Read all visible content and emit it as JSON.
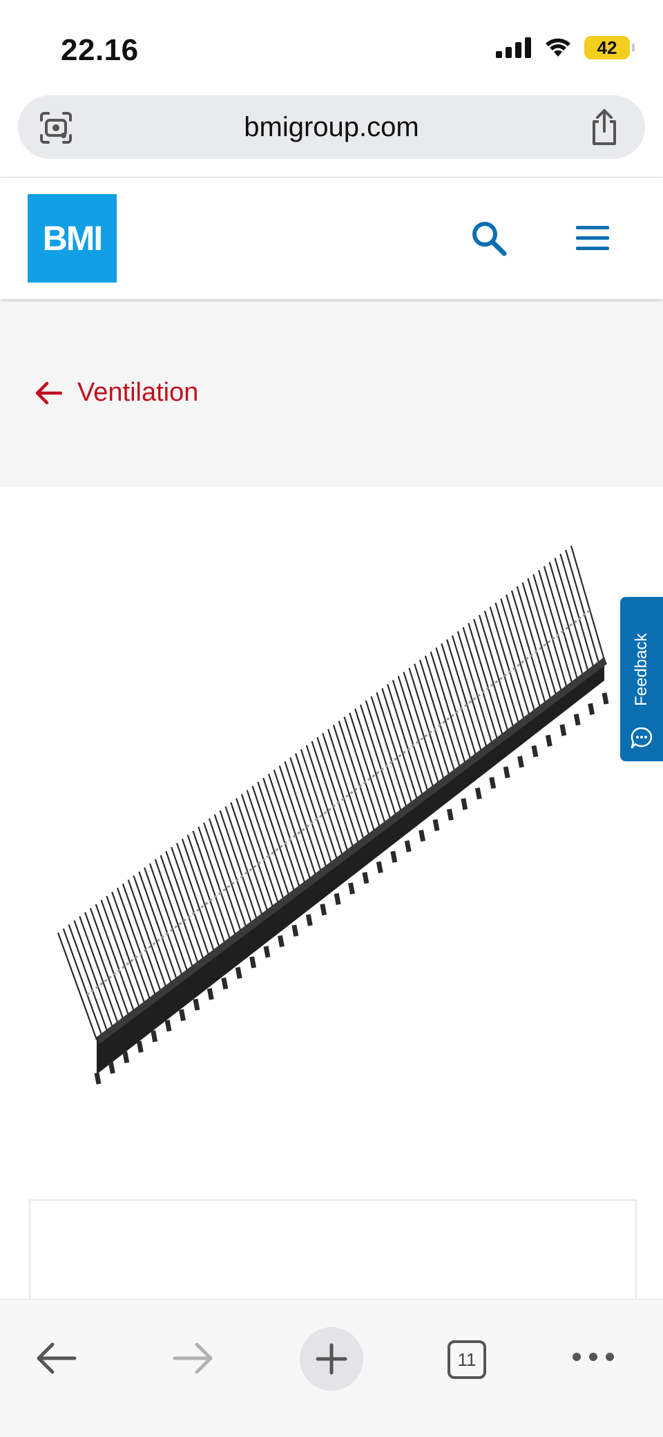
{
  "status_bar": {
    "time": "22.16",
    "battery": "42",
    "icons": [
      "signal-icon",
      "wifi-icon",
      "battery-icon"
    ]
  },
  "browser": {
    "url": "bmigroup.com",
    "left_icon": "visual-search-icon",
    "right_icon": "share-icon"
  },
  "site_header": {
    "logo_text": "BMI",
    "logo_color": "#119fe6",
    "accent_color": "#0a6fb1",
    "icons": [
      "search-icon",
      "hamburger-menu-icon"
    ]
  },
  "breadcrumb": {
    "back_label": "Ventilation",
    "color": "#c0101f"
  },
  "product_image": {
    "description_icon": "eaves-comb-vent-product-image"
  },
  "feedback_tab": {
    "label": "Feedback",
    "icon": "chat-bubble-icon"
  },
  "toolbar": {
    "tabs_count": "11",
    "icons": [
      "back-arrow-icon",
      "forward-arrow-icon",
      "new-tab-plus-icon",
      "tabs-icon",
      "more-icon"
    ]
  }
}
